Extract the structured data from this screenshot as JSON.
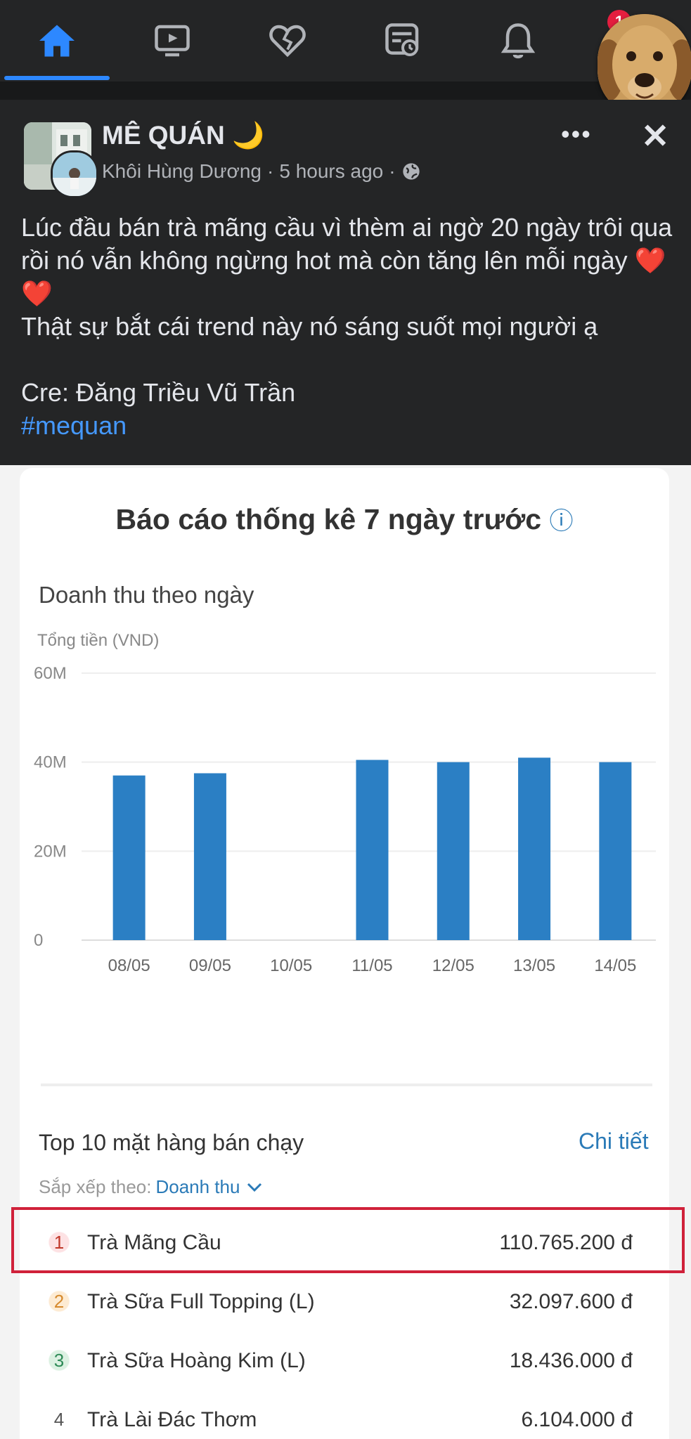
{
  "nav": {
    "items": [
      "home-icon",
      "video-icon",
      "dating-icon",
      "feeds-icon",
      "notifications-icon",
      "messenger-chathead"
    ],
    "badge": "1",
    "active_color": "#2d88ff"
  },
  "post": {
    "group_name": "MÊ QUÁN 🌙",
    "author": "Khôi Hùng Dương",
    "sep1": "·",
    "time": "5 hours ago",
    "sep2": "·",
    "more": "•••",
    "close": "✕",
    "text_line1": "Lúc đầu bán trà mãng cầu vì thèm ai ngờ 20 ngày trôi qua rồi nó vẫn không ngừng hot mà còn tăng lên mỗi ngày ❤️❤️",
    "text_line2": "Thật sự bắt cái trend này nó sáng suốt mọi người ạ",
    "credit": "Cre: Đăng Triều Vũ Trần",
    "hashtag": "#mequan"
  },
  "report": {
    "title": "Báo cáo thống kê 7 ngày trước",
    "info_icon": "ⓘ",
    "subtitle": "Doanh thu theo ngày",
    "unit": "Tổng tiền (VND)",
    "top_title": "Top 10 mặt hàng bán chạy",
    "detail_link": "Chi tiết",
    "sort_label": "Sắp xếp theo:",
    "sort_value": "Doanh thu",
    "items": [
      {
        "rank": "1",
        "name": "Trà Mãng Cầu",
        "value": "110.765.200 đ"
      },
      {
        "rank": "2",
        "name": "Trà Sữa Full Topping (L)",
        "value": "32.097.600 đ"
      },
      {
        "rank": "3",
        "name": "Trà Sữa Hoàng Kim (L)",
        "value": "18.436.000 đ"
      },
      {
        "rank": "4",
        "name": "Trà Lài Đác Thơm",
        "value": "6.104.000 đ"
      }
    ]
  },
  "chart_data": {
    "type": "bar",
    "categories": [
      "08/05",
      "09/05",
      "10/05",
      "11/05",
      "12/05",
      "13/05",
      "14/05"
    ],
    "values": [
      37,
      37.5,
      0,
      40.5,
      40,
      41,
      40
    ],
    "unit_note": "values in millions VND",
    "ylim": [
      0,
      60
    ],
    "yticks": [
      "0",
      "20M",
      "40M",
      "60M"
    ],
    "ytick_values": [
      0,
      20,
      40,
      60
    ],
    "grid": true,
    "bar_color": "#2b7fc4"
  }
}
